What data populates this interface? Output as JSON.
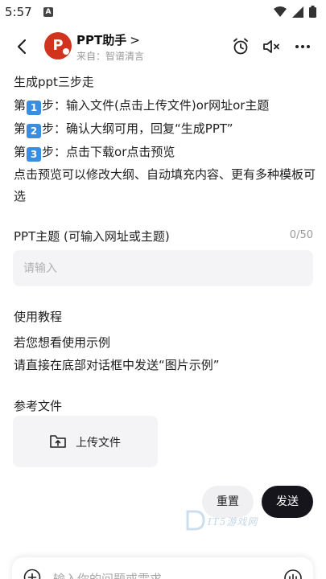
{
  "status_bar": {
    "time": "5:57",
    "app_icon": "A"
  },
  "header": {
    "bot_name": "PPT助手",
    "bot_name_chevron": ">",
    "source": "来自：智谱清言",
    "avatar_letter": "P",
    "accent_color": "#d0341f"
  },
  "message": {
    "intro": "生成ppt三步走",
    "step1_prefix": "第",
    "step1_num": "1",
    "step1_text": "步：输入文件(点击上传文件)or网址or主题",
    "step2_prefix": "第",
    "step2_num": "2",
    "step2_text": "步：确认大纲可用，回复“生成PPT”",
    "step3_prefix": "第",
    "step3_num": "3",
    "step3_text": "步：点击下载or点击预览",
    "preview_note": "点击预览可以修改大纲、自动填充内容、更有多种模板可选"
  },
  "topic_field": {
    "label": "PPT主题 (可输入网址或主题)",
    "count": "0/50",
    "placeholder": "请输入",
    "value": ""
  },
  "tutorial": {
    "title": "使用教程",
    "line1": "若您想看使用示例",
    "line2": "请直接在底部对话框中发送“图片示例”"
  },
  "reference": {
    "title": "参考文件",
    "upload_label": "上传文件"
  },
  "actions": {
    "reset_label": "重置",
    "send_label": "发送"
  },
  "watermark": {
    "text": "IT5游戏网"
  },
  "input_bar": {
    "placeholder": "输入你的问题或需求"
  }
}
